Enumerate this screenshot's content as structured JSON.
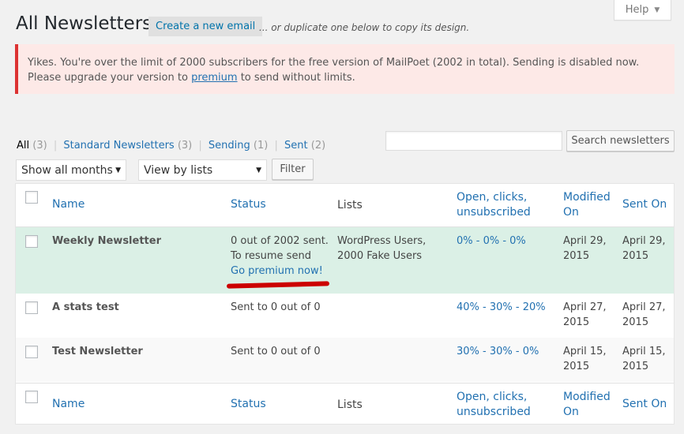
{
  "help": {
    "label": "Help",
    "caret": "▼"
  },
  "header": {
    "title": "All Newsletters",
    "create_label": "Create a new email",
    "duplicate_note": "... or duplicate one below to copy its design."
  },
  "notice": {
    "text_before": "Yikes. You're over the limit of 2000 subscribers for the free version of MailPoet (2002 in total). Sending is disabled now. Please upgrade your version to ",
    "link": "premium",
    "text_after": " to send without limits.",
    "border_color": "#dc3232"
  },
  "filters": {
    "views": [
      {
        "label": "All",
        "count": "(3)"
      },
      {
        "label": "Standard Newsletters",
        "count": "(3)"
      },
      {
        "label": "Sending",
        "count": "(1)"
      },
      {
        "label": "Sent",
        "count": "(2)"
      }
    ],
    "separator": "|",
    "search_placeholder": "",
    "search_button": "Search newsletters",
    "months_select": "Show all months",
    "lists_select": "View by lists",
    "filter_button": "Filter"
  },
  "table": {
    "columns": {
      "name": "Name",
      "status": "Status",
      "lists": "Lists",
      "stats_line1": "Open, clicks,",
      "stats_line2": "unsubscribed",
      "modified_line1": "Modified",
      "modified_line2": "On",
      "sent_on": "Sent On"
    },
    "rows": [
      {
        "name": "Weekly Newsletter",
        "status_line1": "0 out of 2002 sent.",
        "status_line2": "To resume send",
        "status_link": "Go premium now!",
        "lists_line1": "WordPress Users,",
        "lists_line2": "2000 Fake Users",
        "stats": "0% - 0% - 0%",
        "modified_line1": "April 29,",
        "modified_line2": "2015",
        "sent_line1": "April 29,",
        "sent_line2": "2015"
      },
      {
        "name": "A stats test",
        "status_line1": "Sent to 0 out of 0",
        "stats": "40% - 30% - 20%",
        "modified_line1": "April 27,",
        "modified_line2": "2015",
        "sent_line1": "April 27,",
        "sent_line2": "2015"
      },
      {
        "name": "Test Newsletter",
        "status_line1": "Sent to 0 out of 0",
        "stats": "30% - 30% - 0%",
        "modified_line1": "April 15,",
        "modified_line2": "2015",
        "sent_line1": "April 15,",
        "sent_line2": "2015"
      }
    ],
    "highlight_row_color": "#dbf0e6",
    "annotation_color": "#cc0000"
  }
}
